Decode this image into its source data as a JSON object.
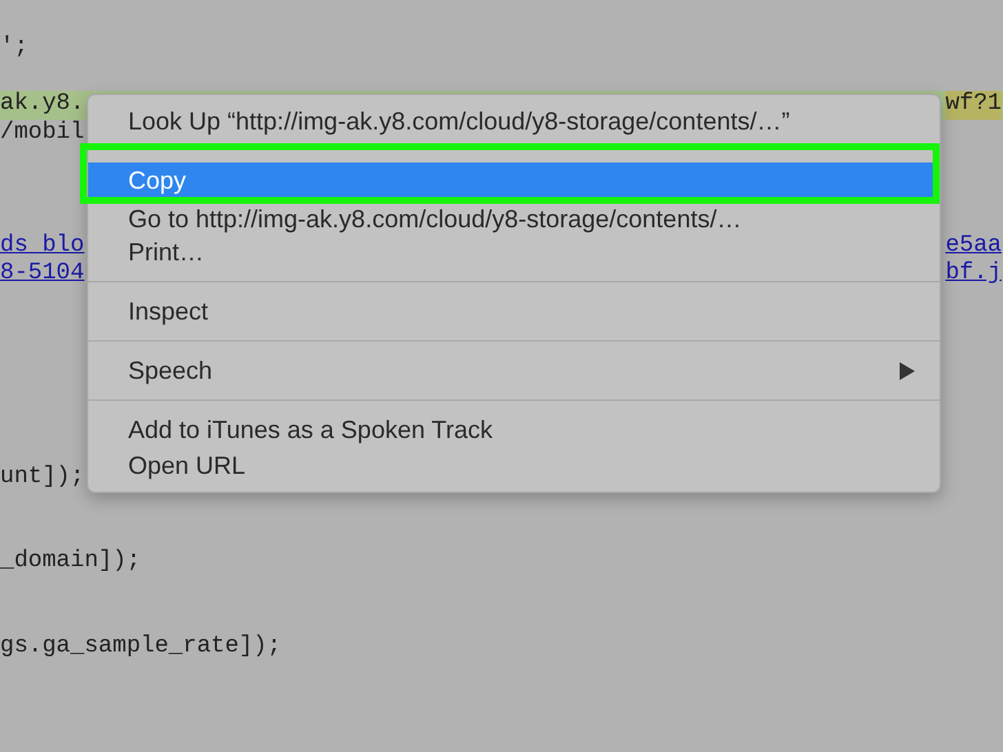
{
  "code_lines": [
    {
      "left": "';",
      "kind": "code",
      "highlighted": false
    },
    {
      "left": "ak.y8.",
      "right": "wf?1",
      "kind": "code",
      "highlighted": true
    },
    {
      "left": "/mobil",
      "kind": "code",
      "highlighted": false
    },
    {
      "left": "ds_blo",
      "right": "e5aa",
      "kind": "link",
      "highlighted": false
    },
    {
      "left": "8-5104",
      "right": "bf.j",
      "kind": "link",
      "highlighted": false
    },
    {
      "left": "unt]);",
      "kind": "code",
      "highlighted": false
    },
    {
      "left": "_domain]);",
      "kind": "code",
      "highlighted": false
    },
    {
      "left": "gs.ga_sample_rate]);",
      "kind": "code",
      "highlighted": false
    }
  ],
  "context_menu": {
    "highlight_frame": true,
    "items": [
      {
        "label": "Look Up “http://img-ak.y8.com/cloud/y8-storage/contents/…”",
        "selected": false,
        "separator_before": false,
        "submenu": false
      },
      {
        "label": "Copy",
        "selected": true,
        "separator_before": false,
        "submenu": false
      },
      {
        "label": "Go to http://img-ak.y8.com/cloud/y8-storage/contents/…",
        "selected": false,
        "separator_before": false,
        "submenu": false
      },
      {
        "label": "Print…",
        "selected": false,
        "separator_before": false,
        "submenu": false
      },
      {
        "label": "Inspect",
        "selected": false,
        "separator_before": true,
        "submenu": false
      },
      {
        "label": "Speech",
        "selected": false,
        "separator_before": true,
        "submenu": true
      },
      {
        "label": "Add to iTunes as a Spoken Track",
        "selected": false,
        "separator_before": true,
        "submenu": false
      },
      {
        "label": "Open URL",
        "selected": false,
        "separator_before": false,
        "submenu": false
      }
    ]
  }
}
